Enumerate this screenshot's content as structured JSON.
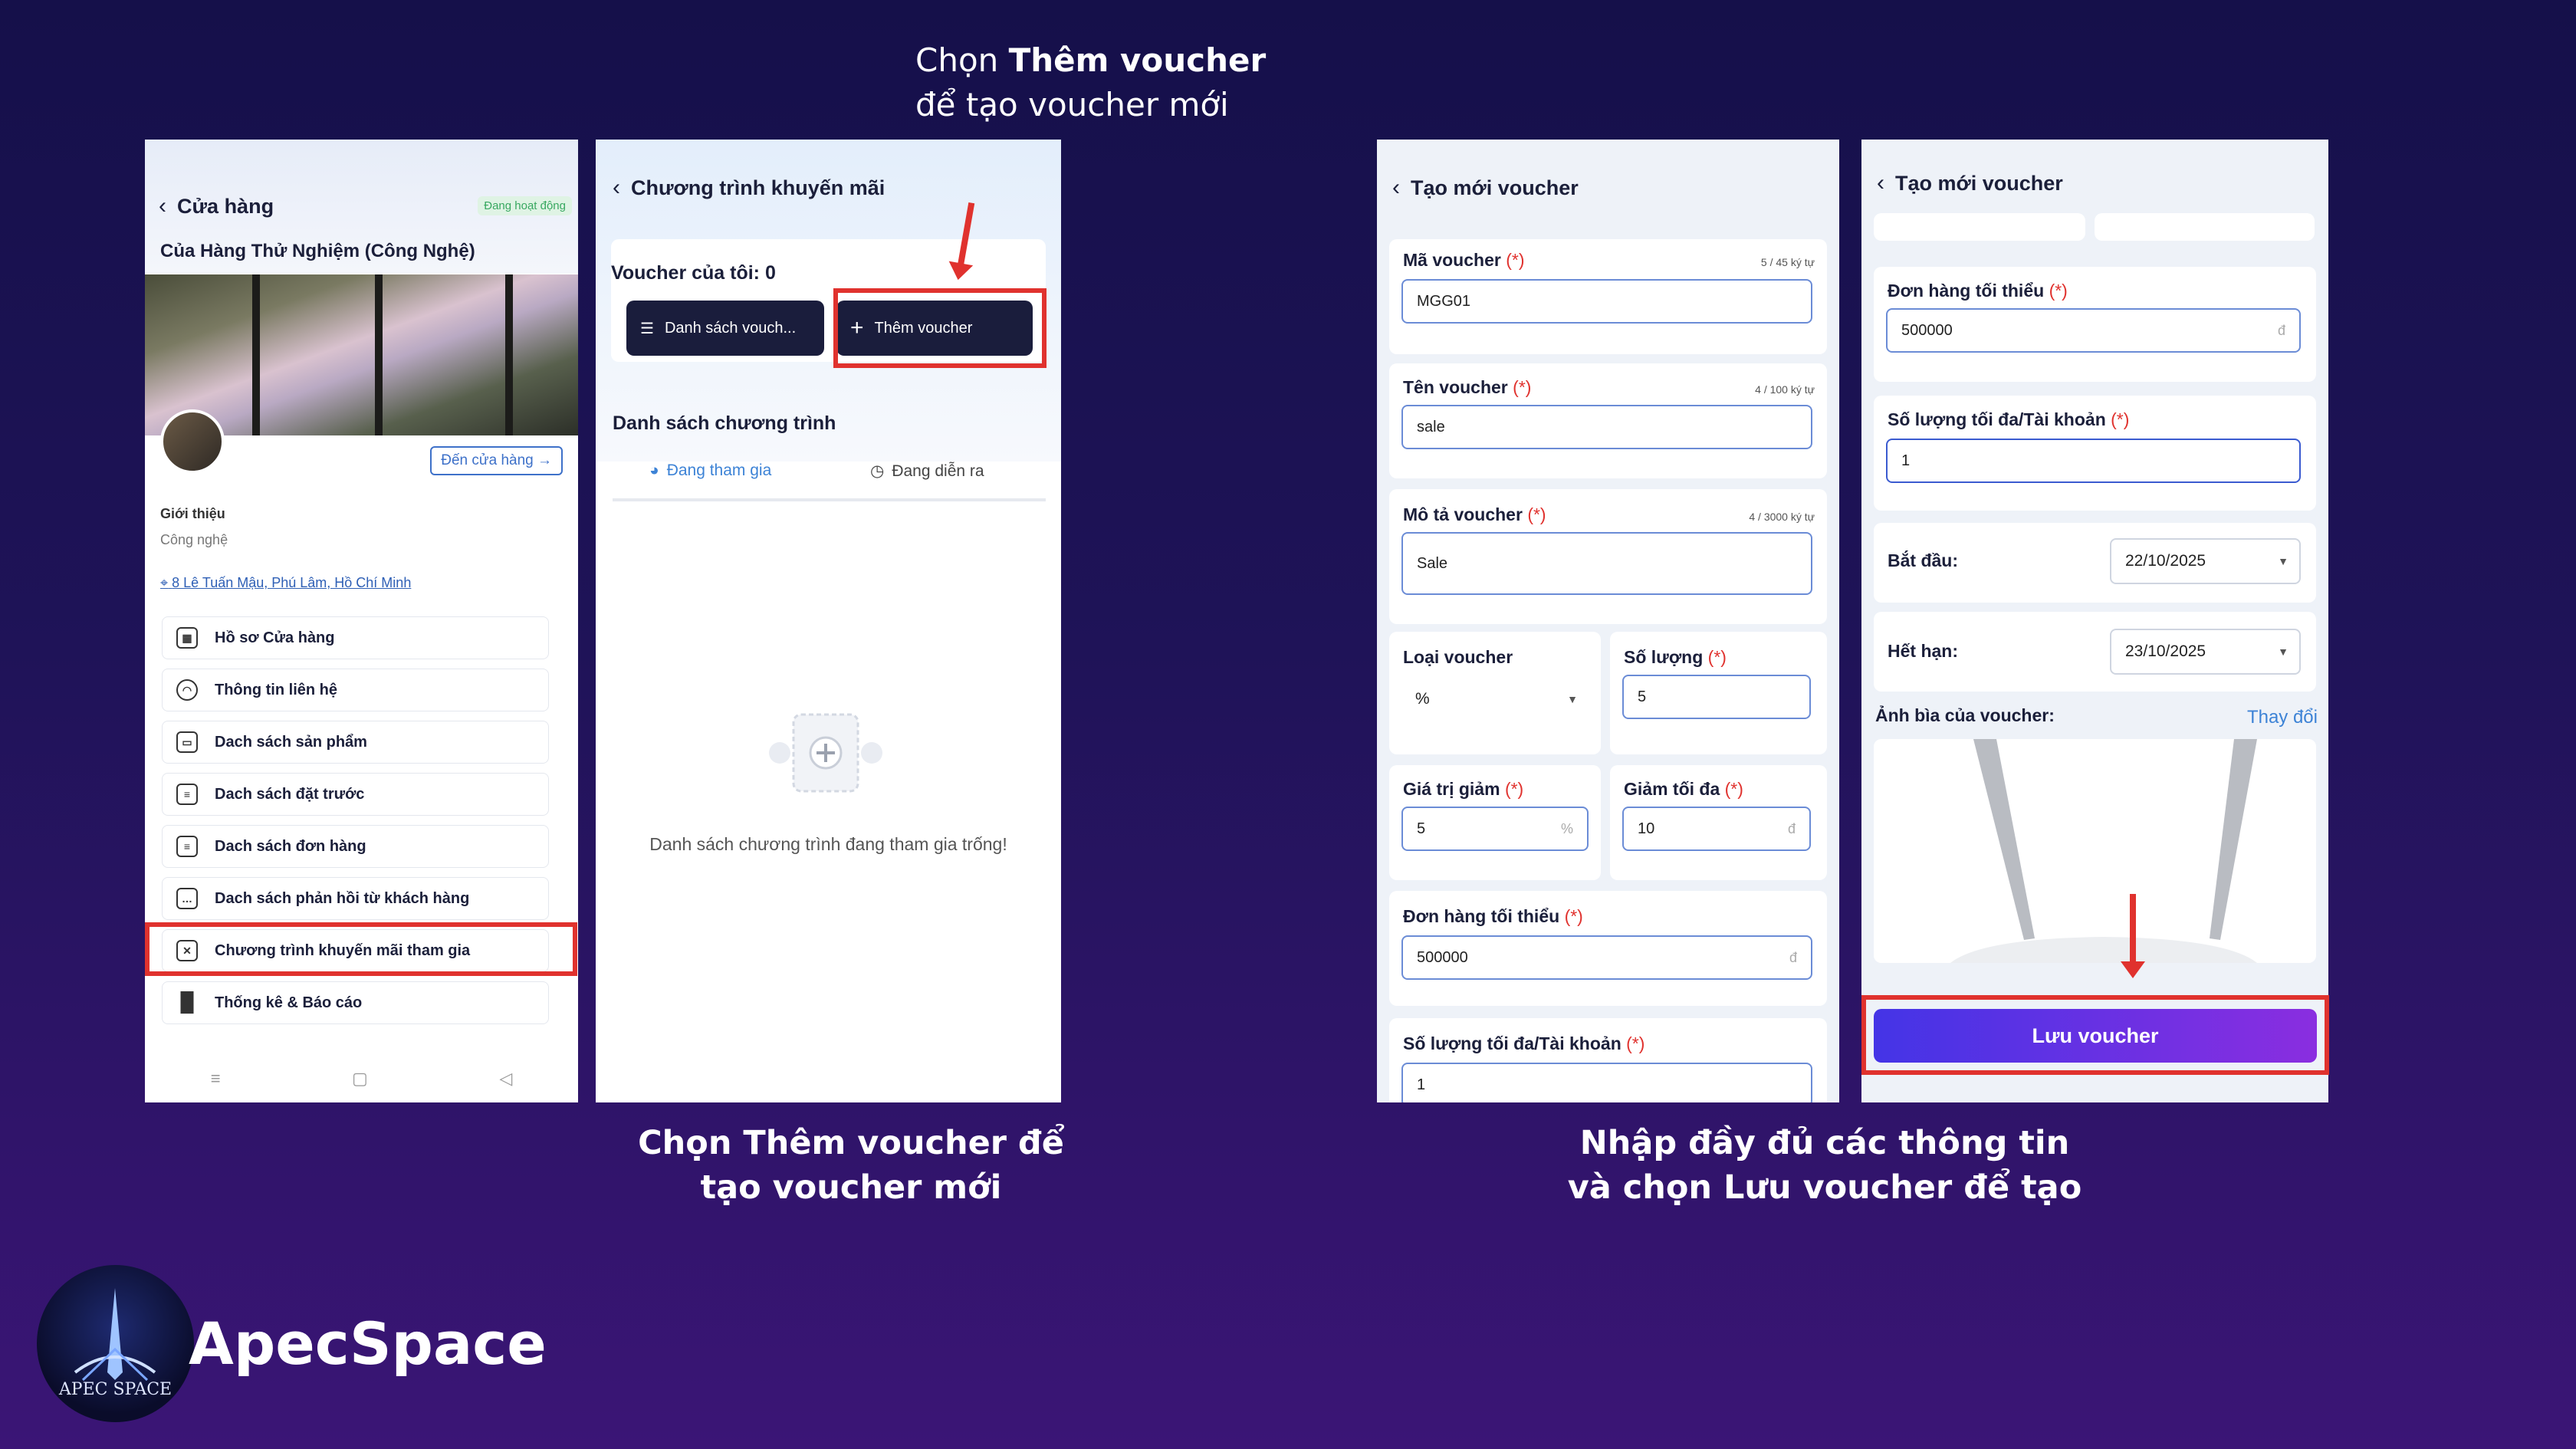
{
  "captions": {
    "top_line1_pre": "Chọn ",
    "top_line1_bold": "Thêm voucher",
    "top_line2": "để tạo voucher mới",
    "bottom_left_line1": "Chọn Thêm voucher để",
    "bottom_left_line2": "tạo voucher mới",
    "bottom_right_line1": "Nhập đầy đủ các thông tin",
    "bottom_right_line2": "và chọn Lưu voucher để tạo"
  },
  "phone1": {
    "back_title": "Cửa hàng",
    "status_badge": "Đang hoạt động",
    "store_name": "Của Hàng Thử Nghiệm (Công Nghệ)",
    "go_store": "Đến cửa hàng",
    "intro_label": "Giới thiệu",
    "intro_value": "Công nghệ",
    "address": "8 Lê Tuấn Mậu, Phú Lâm, Hồ Chí Minh",
    "menu": [
      "Hồ sơ Cửa hàng",
      "Thông tin liên hệ",
      "Dach sách sản phẩm",
      "Dach sách đặt trước",
      "Dach sách đơn hàng",
      "Dach sách phản hồi từ khách hàng",
      "Chương trình khuyến mãi tham gia",
      "Thống kê & Báo cáo"
    ]
  },
  "phone2": {
    "back_title": "Chương trình khuyến mãi",
    "voucher_count": "Voucher của tôi: 0",
    "list_button": "Danh sách vouch...",
    "add_button": "Thêm voucher",
    "section_title": "Danh sách chương trình",
    "tab_joined": "Đang tham gia",
    "tab_ongoing": "Đang diễn ra",
    "empty_text": "Danh sách chương trình đang tham gia trống!"
  },
  "phone3": {
    "back_title": "Tạo mới voucher",
    "code_label": "Mã voucher",
    "code_count": "5 / 45 ký tự",
    "code_value": "MGG01",
    "name_label": "Tên voucher",
    "name_count": "4 / 100 ký tự",
    "name_value": "sale",
    "desc_label": "Mô tả voucher",
    "desc_count": "4 / 3000 ký tự",
    "desc_value": "Sale",
    "type_label": "Loại voucher",
    "type_value": "%",
    "qty_label": "Số lượng",
    "qty_value": "5",
    "discount_label": "Giá trị giảm",
    "discount_value": "5",
    "discount_suffix": "%",
    "max_label": "Giảm tối đa",
    "max_value": "10",
    "max_suffix": "đ",
    "min_order_label": "Đơn hàng tối thiểu",
    "min_order_value": "500000",
    "min_order_suffix": "đ",
    "per_account_label": "Số lượng tối đa/Tài khoản",
    "per_account_value": "1",
    "required_mark": "(*)"
  },
  "phone4": {
    "back_title": "Tạo mới voucher",
    "min_order_label": "Đơn hàng tối thiểu",
    "min_order_value": "500000",
    "min_order_suffix": "đ",
    "per_account_label": "Số lượng tối đa/Tài khoản",
    "per_account_value": "1",
    "start_label": "Bắt đầu:",
    "start_value": "22/10/2025",
    "end_label": "Hết hạn:",
    "end_value": "23/10/2025",
    "cover_label": "Ảnh bìa của voucher:",
    "change_link": "Thay đổi",
    "save_button": "Lưu voucher",
    "required_mark": "(*)"
  },
  "brand": {
    "name": "ApecSpace",
    "logo_text": "APEC SPACE"
  },
  "colors": {
    "highlight": "#e0322e",
    "accent_blue": "#3d83d6",
    "dark_button": "#1a1d3c",
    "save_gradient_start": "#4434e6",
    "save_gradient_end": "#8a2ee0"
  }
}
